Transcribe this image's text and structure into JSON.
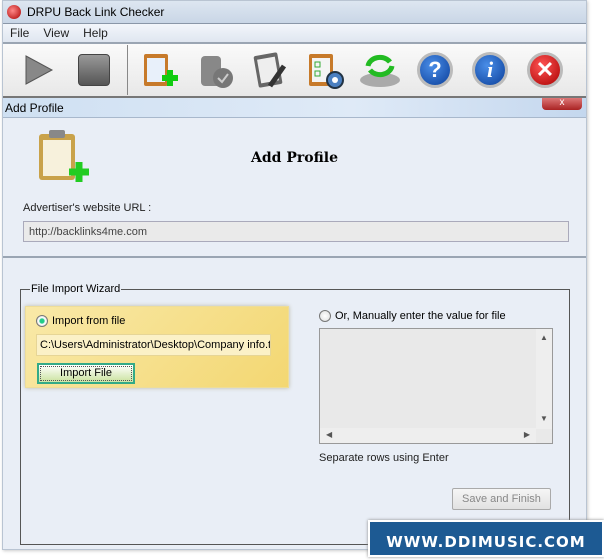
{
  "window": {
    "title": "DRPU Back Link Checker"
  },
  "menu": [
    "File",
    "View",
    "Help"
  ],
  "toolbar": [
    "play",
    "stop",
    "add-profile",
    "delete-profile",
    "edit-profile",
    "settings",
    "update",
    "help",
    "about",
    "exit"
  ],
  "panel": {
    "title": "Add Profile",
    "close": "x",
    "heading": "Add Profile",
    "url_label": "Advertiser's website URL :",
    "url_value": "http://backlinks4me.com"
  },
  "wizard": {
    "title": "File Import Wizard",
    "import_radio": "Import from file",
    "path": "C:\\Users\\Administrator\\Desktop\\Company info.txt",
    "import_button": "Import File",
    "manual_radio": "Or, Manually enter the value for file",
    "manual_value": "",
    "hint": "Separate rows using Enter",
    "save_button": "Save and Finish"
  },
  "banner": "WWW.DDIMUSIC.COM",
  "colors": {
    "banner": "#1d5a93",
    "highlight": "#f3d772"
  }
}
